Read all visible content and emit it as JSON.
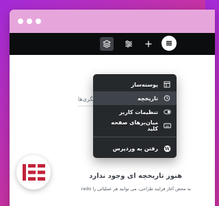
{
  "colors": {
    "background_gradient": [
      "#a42ad8",
      "#c8339e",
      "#e0447c"
    ],
    "titlebar": "#e6a6dc",
    "editor_bar": "#0c0d0e",
    "dropdown": "#26292c",
    "highlight": "#3f444b",
    "brand": "#c1243a"
  },
  "toolbar": {
    "icons": [
      "layers-icon",
      "sliders-icon",
      "plus-icon",
      "menu-icon"
    ]
  },
  "dropdown": {
    "items": [
      {
        "label": "پوسته‌ساز",
        "icon": "theme-builder-icon"
      },
      {
        "label": "تاریخچه",
        "icon": "history-icon",
        "highlighted": true
      },
      {
        "label": "تنظیمات کاربر",
        "icon": "toggle-icon"
      },
      {
        "label": "میان‌برهای صفحه کلید",
        "icon": "keyboard-icon"
      },
      {
        "label": "رفتن به وردپرس",
        "icon": "wordpress-icon"
      }
    ]
  },
  "panel": {
    "tab_label": "نگری‌ها",
    "empty_title": "هنوز تاریخچه ای وجود ندارد",
    "empty_description": "به محض آغاز فرایند طراحی، می توانید هر عملیاتی را redo"
  },
  "logo": {
    "icon": "elementor-logo-icon"
  }
}
